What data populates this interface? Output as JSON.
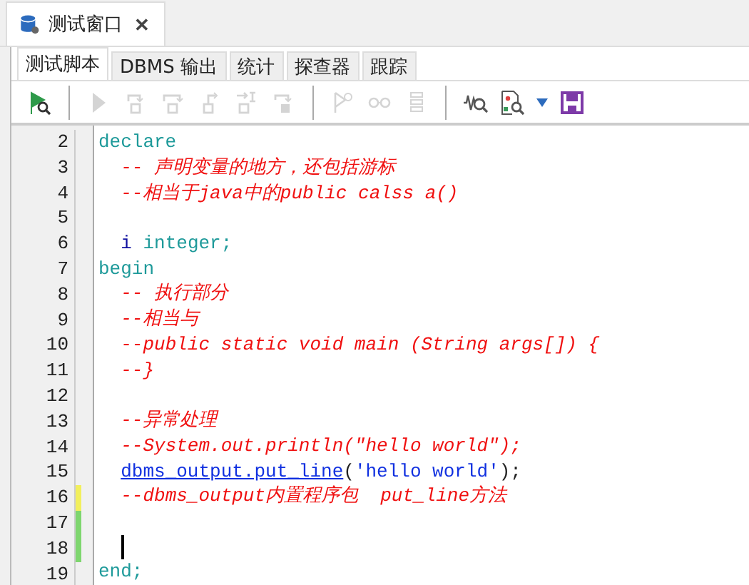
{
  "window_tab": {
    "title": "测试窗口",
    "close": "✕"
  },
  "tabs": [
    {
      "label": "测试脚本",
      "selected": true
    },
    {
      "label": "DBMS 输出",
      "selected": false
    },
    {
      "label": "统计",
      "selected": false
    },
    {
      "label": "探查器",
      "selected": false
    },
    {
      "label": "跟踪",
      "selected": false
    }
  ],
  "toolbar": [
    {
      "kind": "execute-find",
      "disabled": false
    },
    {
      "kind": "separator"
    },
    {
      "kind": "play",
      "disabled": true
    },
    {
      "kind": "step-into",
      "disabled": true
    },
    {
      "kind": "step-over",
      "disabled": true
    },
    {
      "kind": "step-out",
      "disabled": true
    },
    {
      "kind": "run-to-line",
      "disabled": true
    },
    {
      "kind": "step-exception",
      "disabled": true
    },
    {
      "kind": "separator"
    },
    {
      "kind": "breakpoint",
      "disabled": true
    },
    {
      "kind": "watch",
      "disabled": true
    },
    {
      "kind": "stack",
      "disabled": true
    },
    {
      "kind": "separator"
    },
    {
      "kind": "wave-search",
      "disabled": false
    },
    {
      "kind": "doc-search",
      "disabled": false
    },
    {
      "kind": "dropdown",
      "disabled": false
    },
    {
      "kind": "save",
      "disabled": false
    }
  ],
  "editor": {
    "lines": [
      {
        "number": "2",
        "cursor": false,
        "segments": [
          {
            "text": "declare",
            "kind": "keyword"
          }
        ]
      },
      {
        "number": "3",
        "cursor": false,
        "segments": [
          {
            "text": "  -- 声明变量的地方，还包括游标",
            "kind": "comment"
          }
        ]
      },
      {
        "number": "4",
        "cursor": false,
        "segments": [
          {
            "text": "  --相当于java中的public calss a()",
            "kind": "comment"
          }
        ]
      },
      {
        "number": "5",
        "cursor": false
      },
      {
        "number": "6",
        "cursor": false,
        "segments": [
          {
            "text": "  i",
            "kind": "identifier"
          },
          {
            "text": " integer;",
            "kind": "keyword"
          }
        ]
      },
      {
        "number": "7",
        "cursor": false,
        "segments": [
          {
            "text": "begin",
            "kind": "keyword"
          }
        ]
      },
      {
        "number": "8",
        "cursor": false,
        "segments": [
          {
            "text": "  -- 执行部分",
            "kind": "comment"
          }
        ]
      },
      {
        "number": "9",
        "cursor": false,
        "segments": [
          {
            "text": "  --相当与",
            "kind": "comment"
          }
        ]
      },
      {
        "number": "10",
        "cursor": false,
        "segments": [
          {
            "text": "  --public static void main (String args[]) {",
            "kind": "comment"
          }
        ]
      },
      {
        "number": "11",
        "cursor": false,
        "segments": [
          {
            "text": "  --}",
            "kind": "comment"
          }
        ]
      },
      {
        "number": "12",
        "cursor": false
      },
      {
        "number": "13",
        "cursor": false,
        "segments": [
          {
            "text": "  --异常处理",
            "kind": "comment"
          }
        ]
      },
      {
        "number": "14",
        "cursor": false,
        "segments": [
          {
            "text": "  --System.out.println(\"hello world\");",
            "kind": "comment"
          }
        ]
      },
      {
        "number": "15",
        "cursor": false,
        "segments": [
          {
            "text": "  dbms_output.put_line",
            "kind": "package"
          },
          {
            "text": "(",
            "kind": "plain"
          },
          {
            "text": "'hello world'",
            "kind": "string"
          },
          {
            "text": ");",
            "kind": "plain"
          }
        ]
      },
      {
        "number": "16",
        "color": "#f2ef5c",
        "cursor": false,
        "segments": [
          {
            "text": "  --dbms_output内置程序包  put_line方法",
            "kind": "comment"
          }
        ]
      },
      {
        "number": "17",
        "color": "#7ed66e",
        "cursor": false
      },
      {
        "number": "18",
        "color": "#7ed66e",
        "cursor": true
      },
      {
        "number": "19",
        "cursor": false,
        "segments": [
          {
            "text": "end;",
            "kind": "keyword"
          }
        ]
      }
    ]
  }
}
